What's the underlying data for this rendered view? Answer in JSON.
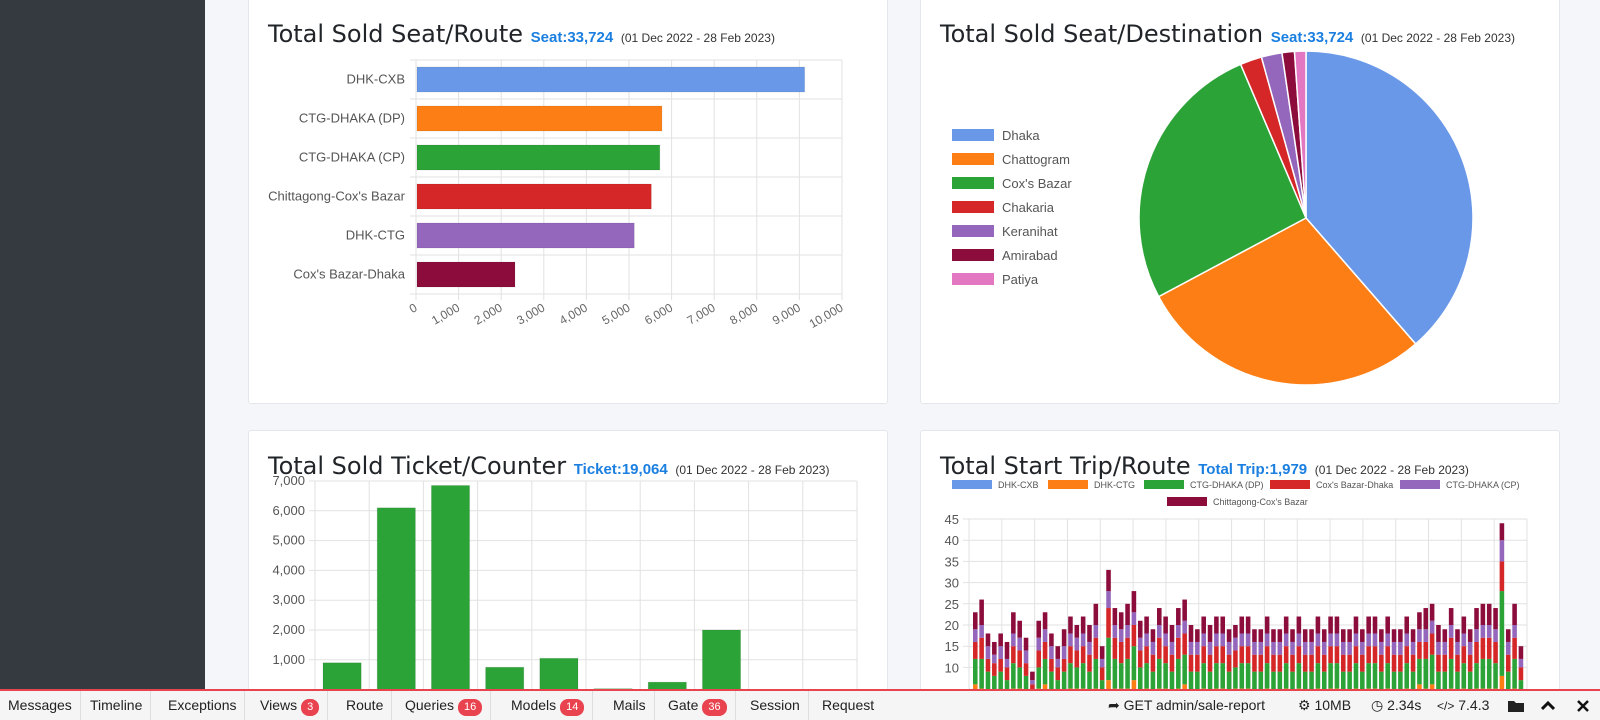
{
  "cards": {
    "route_seats": {
      "title": "Total Sold Seat/Route",
      "stat": "Seat:33,724",
      "range": "(01 Dec 2022 - 28 Feb 2023)"
    },
    "destination_seats": {
      "title": "Total Sold Seat/Destination",
      "stat": "Seat:33,724",
      "range": "(01 Dec 2022 - 28 Feb 2023)"
    },
    "counter_tickets": {
      "title": "Total Sold Ticket/Counter",
      "stat": "Ticket:19,064",
      "range": "(01 Dec 2022 - 28 Feb 2023)"
    },
    "route_trips": {
      "title": "Total Start Trip/Route",
      "stat": "Total Trip:1,979",
      "range": "(01 Dec 2022 - 28 Feb 2023)"
    }
  },
  "chart_data": [
    {
      "type": "bar",
      "orientation": "horizontal",
      "categories": [
        "DHK-CXB",
        "CTG-DHAKA (DP)",
        "CTG-DHAKA (CP)",
        "Chittagong-Cox's Bazar",
        "DHK-CTG",
        "Cox's Bazar-Dhaka"
      ],
      "values": [
        9100,
        5750,
        5700,
        5500,
        5100,
        2300
      ],
      "colors": [
        "#6a98e8",
        "#fd7e14",
        "#2ca337",
        "#d62728",
        "#9467bd",
        "#8c0d3c"
      ],
      "xlim": [
        0,
        10000
      ],
      "xticks": [
        "0",
        "1,000",
        "2,000",
        "3,000",
        "4,000",
        "5,000",
        "6,000",
        "7,000",
        "8,000",
        "9,000",
        "10,000"
      ],
      "grid": true
    },
    {
      "type": "pie",
      "labels": [
        "Dhaka",
        "Chattogram",
        "Cox's Bazar",
        "Chakaria",
        "Keranihat",
        "Amirabad",
        "Patiya"
      ],
      "values": [
        38.6,
        28.6,
        26.4,
        2.1,
        2.0,
        1.2,
        1.1
      ],
      "colors": [
        "#6a98e8",
        "#fd7e14",
        "#2ca337",
        "#d62728",
        "#9467bd",
        "#8c0d3c",
        "#e377c2"
      ],
      "legend": "left"
    },
    {
      "type": "bar",
      "values": [
        900,
        6100,
        6850,
        750,
        1050,
        30,
        250,
        2000
      ],
      "color": "#2ca337",
      "ylim": [
        600,
        7000
      ],
      "yticks": [
        "7,000",
        "6,000",
        "5,000",
        "4,000",
        "3,000",
        "2,000",
        "1,000"
      ],
      "grid": true
    },
    {
      "type": "bar",
      "stacked": true,
      "series": [
        {
          "name": "DHK-CXB",
          "color": "#6a98e8",
          "values": [
            1,
            0,
            0,
            1,
            0,
            0,
            0,
            1,
            0,
            0,
            0,
            1,
            0,
            0,
            0,
            0,
            1,
            0,
            0,
            0,
            0,
            0,
            0,
            0,
            0,
            1,
            0,
            0,
            0,
            0,
            0,
            0,
            0,
            1,
            0,
            0,
            0,
            0,
            0,
            0,
            0,
            1,
            0,
            0,
            0,
            0,
            0,
            0,
            0,
            0,
            0,
            0,
            0,
            0,
            0,
            0,
            0,
            0,
            0,
            0,
            0,
            0,
            0,
            0,
            0,
            0,
            0,
            0,
            0,
            0,
            1,
            0,
            0,
            0,
            0,
            0,
            0,
            0,
            0,
            0,
            0,
            0,
            0,
            0,
            0,
            0,
            0
          ]
        },
        {
          "name": "DHK-CTG",
          "color": "#fd7e14",
          "values": [
            5,
            5,
            4,
            3,
            4,
            3,
            5,
            4,
            4,
            2,
            5,
            5,
            4,
            3,
            4,
            5,
            4,
            5,
            4,
            5,
            3,
            7,
            5,
            5,
            5,
            6,
            4,
            5,
            4,
            5,
            5,
            4,
            5,
            5,
            4,
            4,
            5,
            4,
            5,
            5,
            4,
            4,
            5,
            5,
            4,
            4,
            5,
            4,
            4,
            5,
            4,
            5,
            4,
            4,
            5,
            4,
            5,
            5,
            4,
            4,
            5,
            4,
            5,
            5,
            4,
            5,
            4,
            4,
            5,
            4,
            5,
            5,
            6,
            4,
            4,
            5,
            4,
            5,
            4,
            5,
            5,
            5,
            5,
            8,
            4,
            5,
            3
          ]
        },
        {
          "name": "CTG-DHAKA (DP)",
          "color": "#2ca337",
          "values": [
            6,
            7,
            5,
            4,
            5,
            4,
            6,
            5,
            4,
            2,
            5,
            6,
            5,
            4,
            5,
            6,
            5,
            6,
            5,
            7,
            4,
            10,
            7,
            6,
            7,
            8,
            6,
            6,
            5,
            7,
            6,
            5,
            7,
            7,
            5,
            5,
            6,
            5,
            6,
            6,
            5,
            5,
            6,
            6,
            5,
            5,
            6,
            5,
            5,
            6,
            5,
            6,
            5,
            5,
            6,
            5,
            6,
            6,
            5,
            5,
            6,
            5,
            6,
            6,
            5,
            6,
            5,
            5,
            6,
            5,
            6,
            7,
            7,
            5,
            5,
            7,
            5,
            6,
            5,
            6,
            7,
            7,
            6,
            20,
            5,
            7,
            4
          ]
        },
        {
          "name": "Cox's Bazar-Dhaka",
          "color": "#d62728",
          "values": [
            4,
            5,
            3,
            3,
            3,
            3,
            4,
            4,
            3,
            2,
            4,
            4,
            3,
            3,
            3,
            4,
            4,
            4,
            4,
            5,
            3,
            7,
            5,
            5,
            5,
            5,
            4,
            4,
            4,
            5,
            4,
            4,
            5,
            5,
            4,
            4,
            4,
            4,
            4,
            4,
            4,
            4,
            4,
            4,
            4,
            4,
            4,
            4,
            4,
            4,
            4,
            4,
            4,
            4,
            4,
            4,
            4,
            4,
            4,
            4,
            4,
            4,
            4,
            4,
            4,
            4,
            4,
            4,
            4,
            4,
            4,
            4,
            5,
            4,
            4,
            5,
            4,
            4,
            4,
            5,
            5,
            5,
            5,
            7,
            4,
            5,
            3
          ]
        },
        {
          "name": "CTG-DHAKA (CP)",
          "color": "#9467bd",
          "values": [
            3,
            3,
            3,
            2,
            3,
            2,
            3,
            3,
            3,
            1,
            3,
            3,
            3,
            2,
            3,
            3,
            3,
            3,
            3,
            3,
            2,
            4,
            3,
            3,
            3,
            3,
            3,
            3,
            3,
            3,
            3,
            3,
            3,
            3,
            3,
            3,
            3,
            3,
            3,
            3,
            3,
            3,
            3,
            3,
            3,
            3,
            3,
            3,
            3,
            3,
            3,
            3,
            3,
            3,
            3,
            3,
            3,
            3,
            3,
            3,
            3,
            3,
            3,
            3,
            3,
            3,
            3,
            3,
            3,
            3,
            3,
            3,
            3,
            3,
            3,
            3,
            3,
            3,
            3,
            3,
            3,
            3,
            3,
            5,
            3,
            3,
            2
          ]
        },
        {
          "name": "Chittagong-Cox's Bazar",
          "color": "#8c0d3c",
          "values": [
            4,
            6,
            3,
            3,
            3,
            4,
            5,
            4,
            3,
            2,
            4,
            4,
            3,
            3,
            4,
            4,
            3,
            4,
            4,
            5,
            3,
            5,
            4,
            4,
            5,
            5,
            4,
            4,
            3,
            4,
            4,
            4,
            4,
            5,
            4,
            3,
            4,
            4,
            4,
            4,
            3,
            3,
            4,
            4,
            3,
            3,
            4,
            3,
            3,
            4,
            3,
            4,
            3,
            3,
            4,
            3,
            4,
            4,
            3,
            3,
            4,
            3,
            4,
            4,
            3,
            4,
            3,
            3,
            4,
            3,
            4,
            5,
            4,
            4,
            3,
            4,
            3,
            4,
            3,
            5,
            5,
            5,
            5,
            4,
            3,
            5,
            3
          ]
        }
      ],
      "ylim": [
        7,
        45
      ],
      "yticks": [
        "45",
        "40",
        "35",
        "30",
        "25",
        "20",
        "15",
        "10"
      ],
      "grid": true,
      "legend": "top"
    }
  ],
  "debugbar": {
    "tabs": [
      {
        "label": "Messages"
      },
      {
        "label": "Timeline"
      },
      {
        "label": "Exceptions"
      },
      {
        "label": "Views",
        "badge": "3"
      },
      {
        "label": "Route"
      },
      {
        "label": "Queries",
        "badge": "16"
      },
      {
        "label": "Models",
        "badge": "14"
      },
      {
        "label": "Mails"
      },
      {
        "label": "Gate",
        "badge": "36"
      },
      {
        "label": "Session"
      },
      {
        "label": "Request"
      }
    ],
    "request": "GET admin/sale-report",
    "memory": "10MB",
    "time": "2.34s",
    "version": "7.4.3",
    "icons": [
      "share-arrow-icon",
      "gears-icon",
      "clock-icon",
      "code-icon",
      "folder-icon",
      "chevron-up-icon",
      "close-icon"
    ]
  }
}
